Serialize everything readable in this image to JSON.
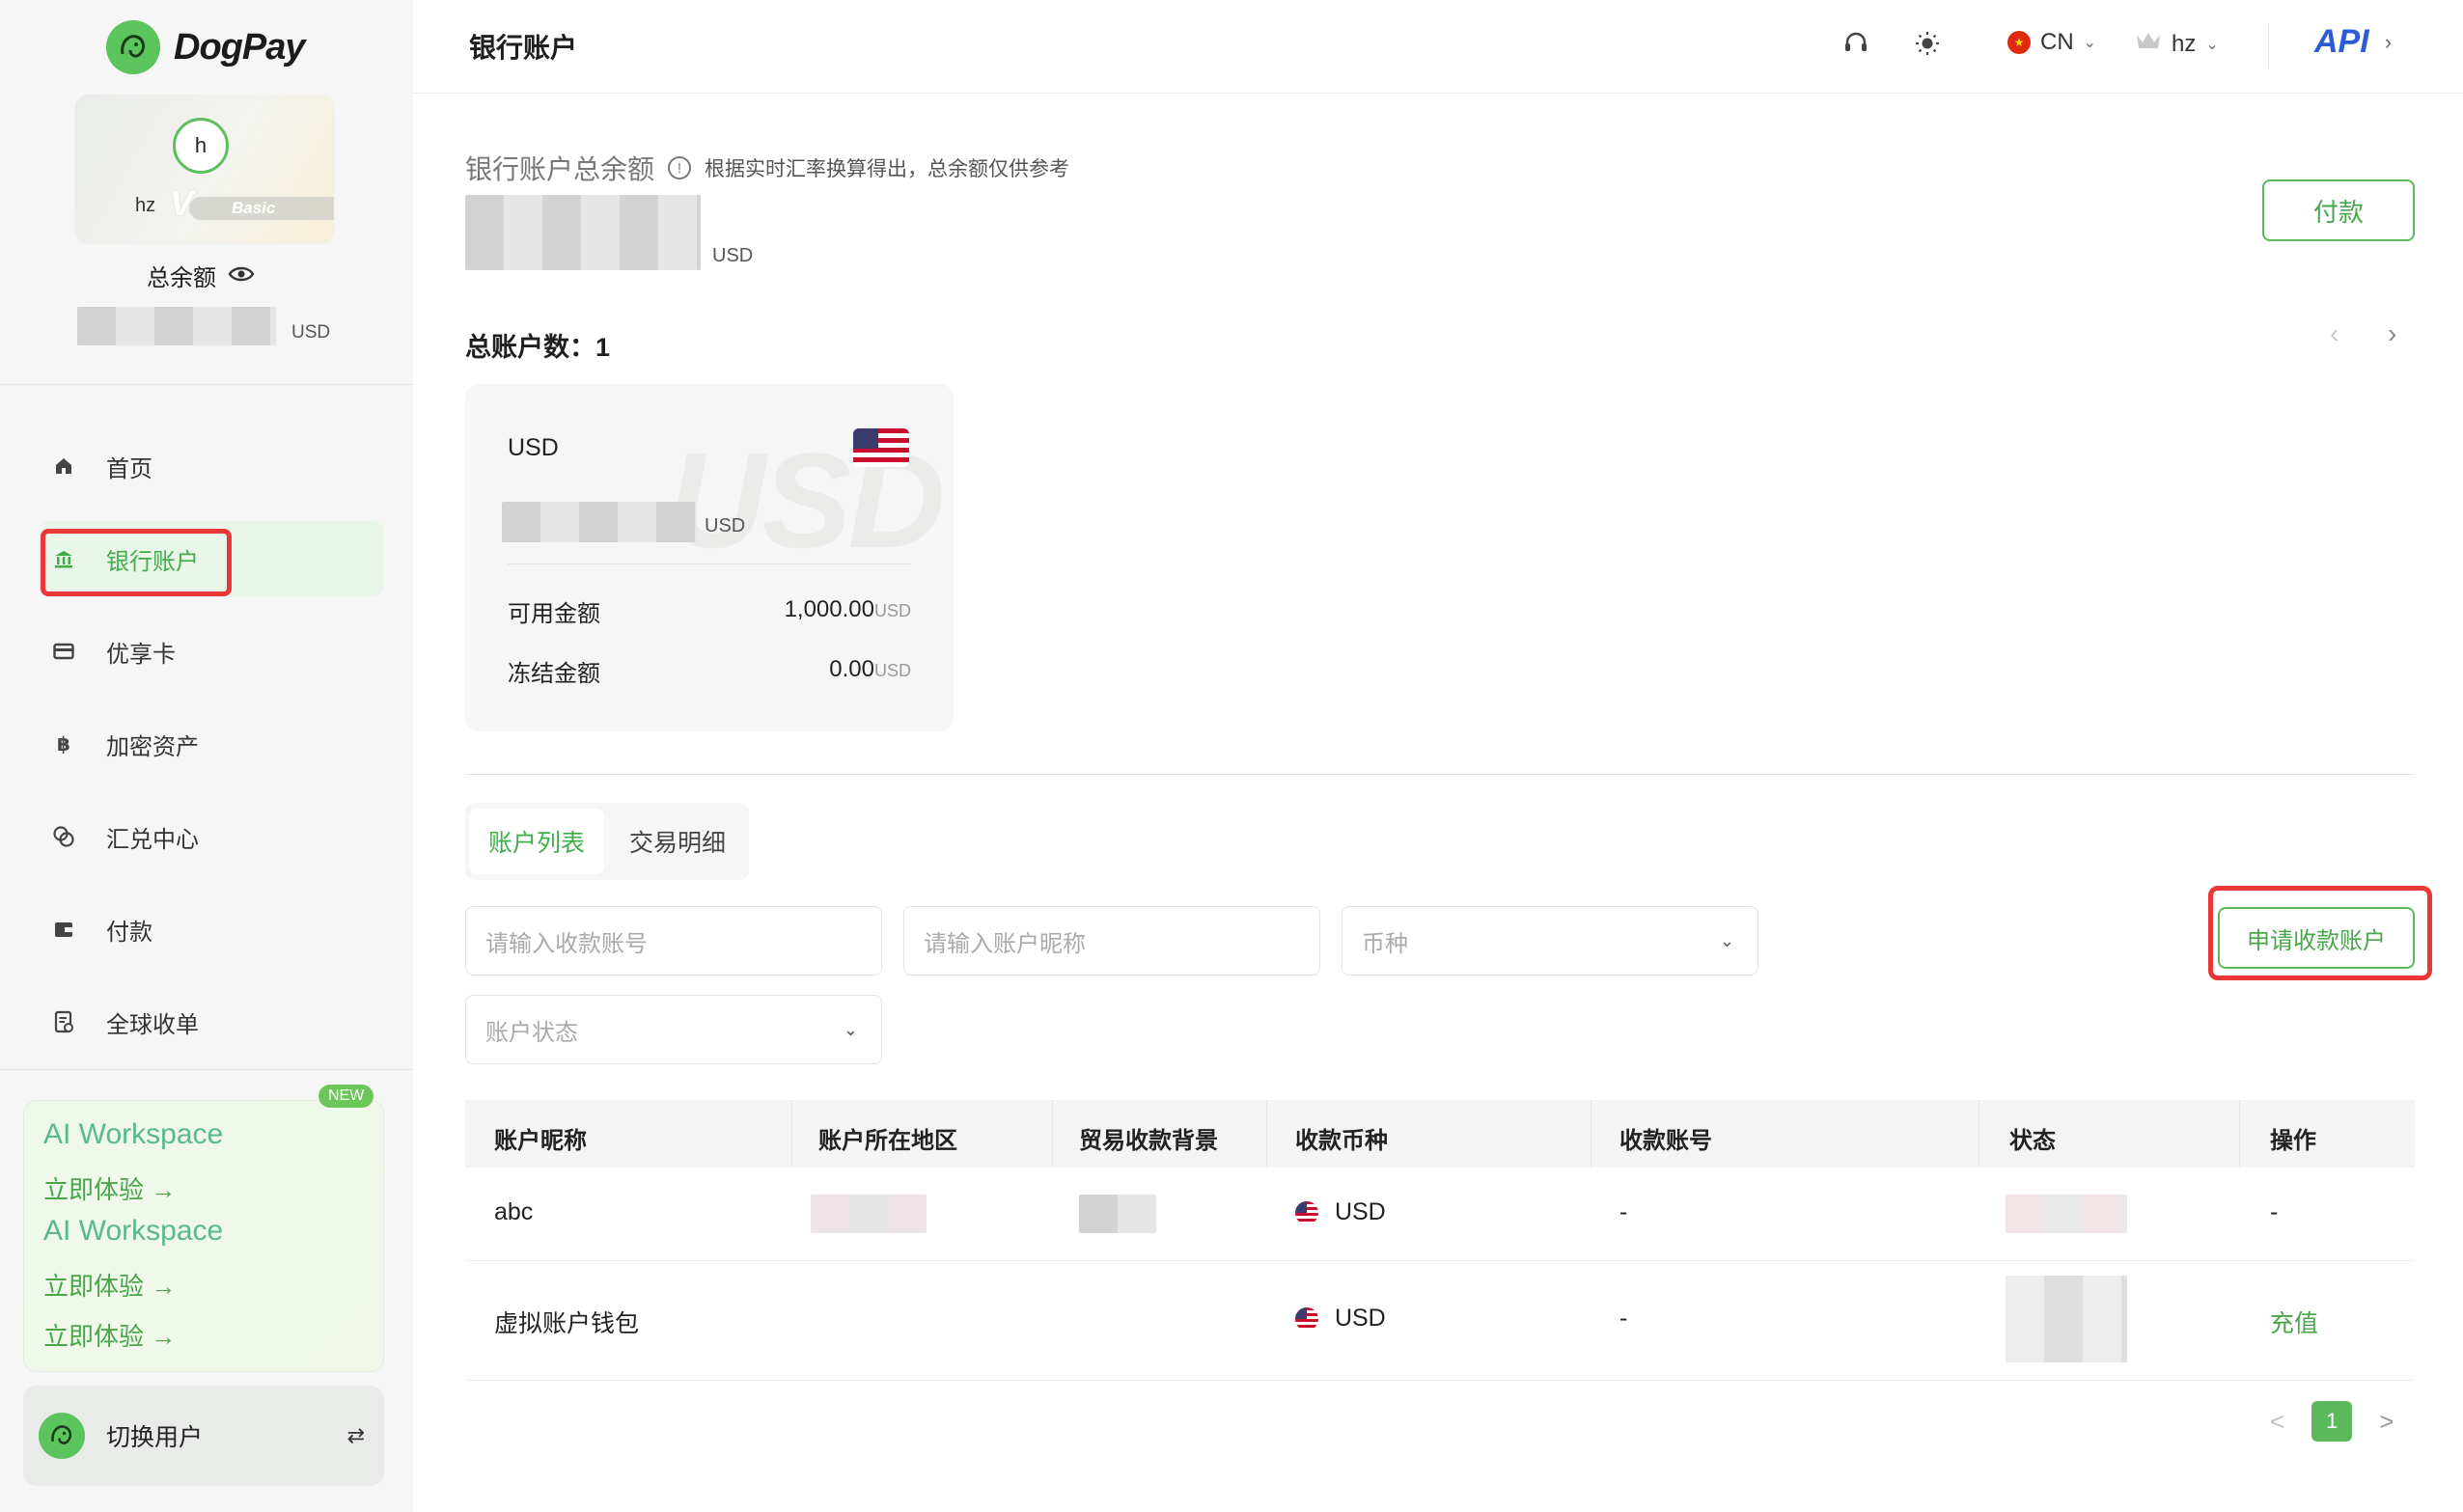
{
  "app": {
    "name": "DogPay"
  },
  "sidebar": {
    "profile": {
      "avatar_initial": "h",
      "username": "hz",
      "v_mark": "V",
      "level": "Basic"
    },
    "balance": {
      "label": "总余额",
      "currency": "USD"
    },
    "nav": [
      {
        "label": "首页",
        "icon": "home-icon"
      },
      {
        "label": "银行账户",
        "icon": "bank-icon",
        "active": true
      },
      {
        "label": "优享卡",
        "icon": "card-icon"
      },
      {
        "label": "加密资产",
        "icon": "bitcoin-icon"
      },
      {
        "label": "汇兑中心",
        "icon": "exchange-icon"
      },
      {
        "label": "付款",
        "icon": "wallet-icon"
      },
      {
        "label": "全球收单",
        "icon": "receipt-icon"
      }
    ],
    "ai": {
      "badge": "NEW",
      "title": "AI Workspace",
      "cta": "立即体验 →"
    },
    "switch_user": {
      "label": "切换用户",
      "icon": "swap-icon"
    }
  },
  "header": {
    "title": "银行账户",
    "language": "CN",
    "user": "hz",
    "api": "API"
  },
  "summary": {
    "title": "银行账户总余额",
    "note": "根据实时汇率换算得出，总余额仅供参考",
    "currency": "USD",
    "pay_button": "付款",
    "account_count_label": "总账户数：",
    "account_count": "1"
  },
  "account_card": {
    "currency": "USD",
    "watermark": "USD",
    "balance_currency": "USD",
    "available_label": "可用金额",
    "available_value": "1,000.00",
    "available_unit": "USD",
    "frozen_label": "冻结金额",
    "frozen_value": "0.00",
    "frozen_unit": "USD"
  },
  "tabs": [
    {
      "label": "账户列表",
      "active": true
    },
    {
      "label": "交易明细",
      "active": false
    }
  ],
  "filters": {
    "account_number_placeholder": "请输入收款账号",
    "nickname_placeholder": "请输入账户昵称",
    "currency_placeholder": "币种",
    "status_placeholder": "账户状态",
    "apply_button": "申请收款账户"
  },
  "table": {
    "headers": [
      "账户昵称",
      "账户所在地区",
      "贸易收款背景",
      "收款币种",
      "收款账号",
      "状态",
      "操作"
    ],
    "rows": [
      {
        "nickname": "abc",
        "currency": "USD",
        "account_no": "-",
        "action": "-"
      },
      {
        "nickname": "虚拟账户钱包",
        "currency": "USD",
        "account_no": "-",
        "action": "充值"
      }
    ]
  },
  "pagination": {
    "current": "1",
    "prev": "<",
    "next": ">"
  }
}
